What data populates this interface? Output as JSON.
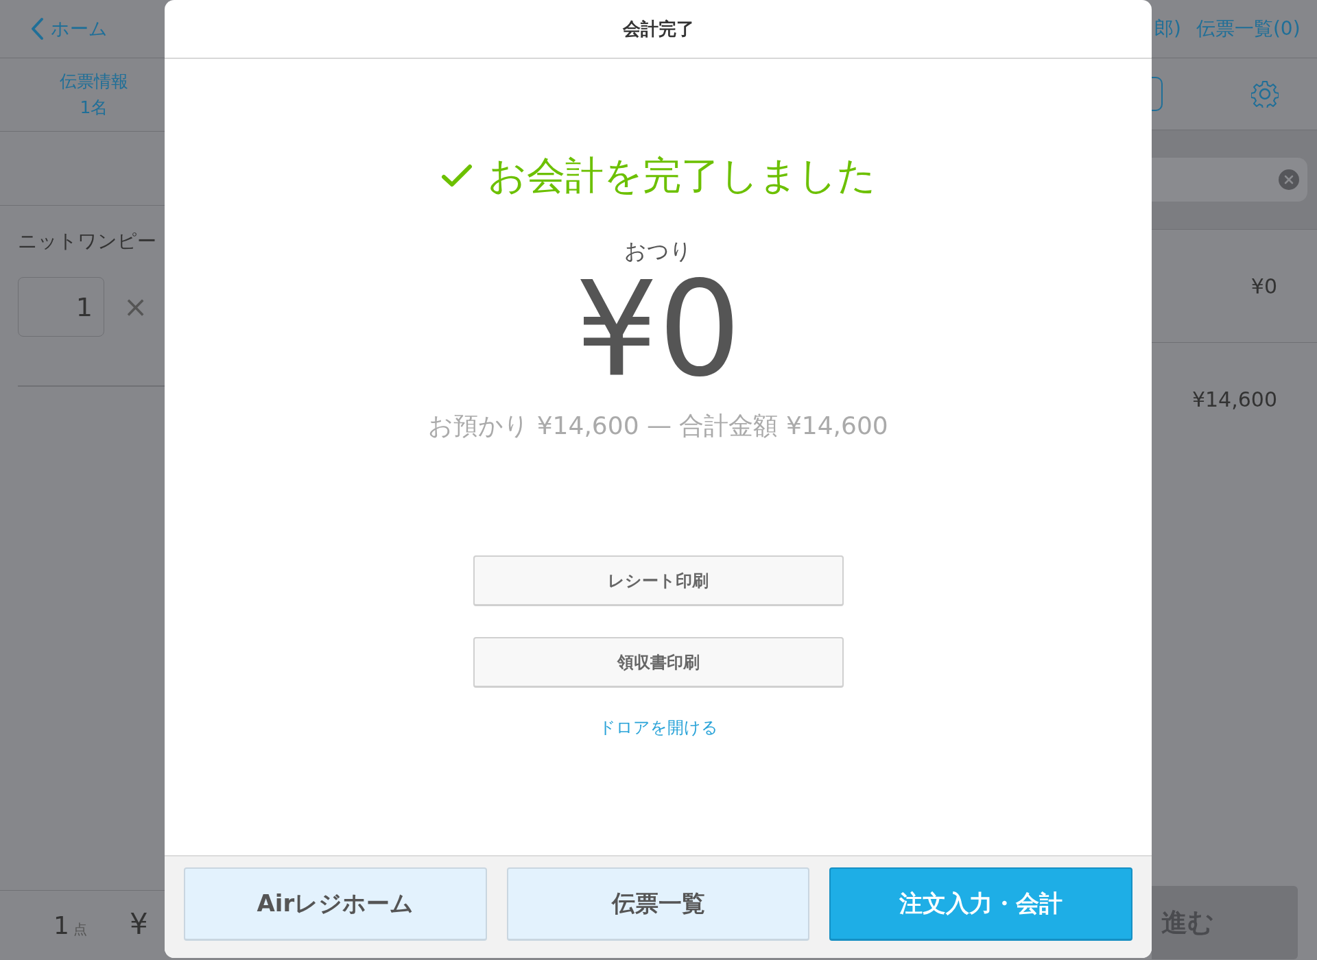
{
  "background": {
    "left": {
      "back_link": "ホーム",
      "ticket_info": {
        "label": "伝票情報",
        "guests": "1名"
      },
      "item": {
        "name": "ニットワンピー",
        "quantity": "1",
        "times": "×"
      },
      "footer": {
        "count": "1",
        "unit": "点",
        "total": "¥"
      }
    },
    "right": {
      "guest_name": "郎)",
      "ticket_list": "伝票一覧(0)",
      "rows": [
        {
          "amount": "¥0"
        },
        {
          "amount": "¥14,600"
        }
      ],
      "proceed_button": "進む"
    }
  },
  "dialog": {
    "title": "会計完了",
    "message": "お会計を完了しました",
    "change_label": "おつり",
    "change_amount": "¥0",
    "summary": "お預かり ¥14,600 — 合計金額 ¥14,600",
    "actions": [
      {
        "label": "レシート印刷"
      },
      {
        "label": "領収書印刷"
      }
    ],
    "drawer_link": "ドロアを開ける",
    "footer_buttons": [
      {
        "label": "Airレジホーム",
        "primary": false
      },
      {
        "label": "伝票一覧",
        "primary": false
      },
      {
        "label": "注文入力・会計",
        "primary": true
      }
    ]
  }
}
